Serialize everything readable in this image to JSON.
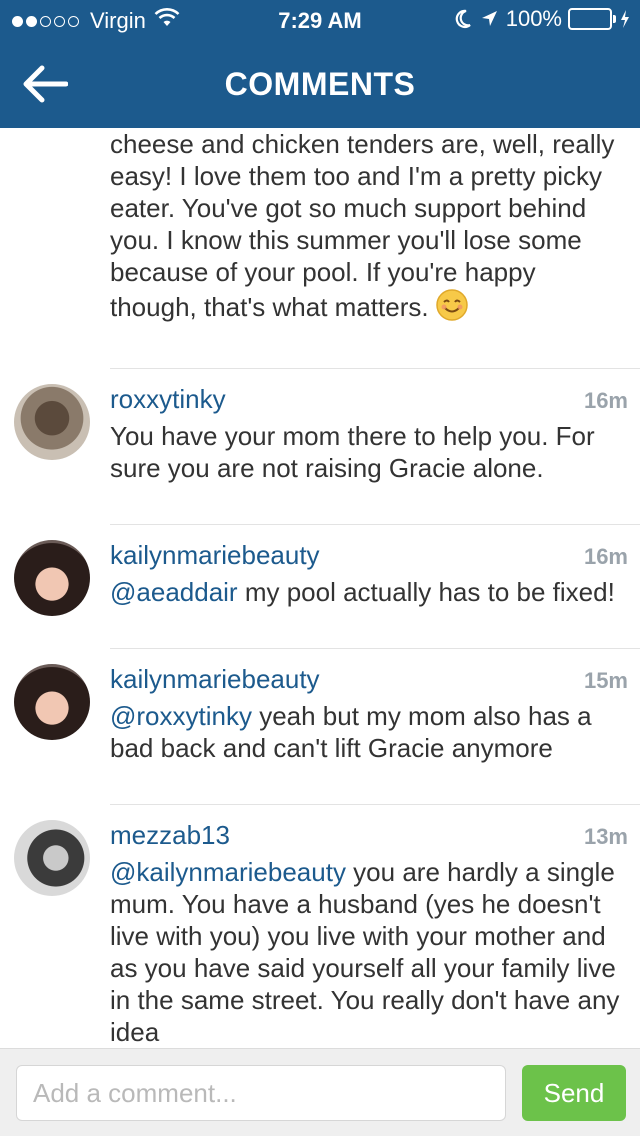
{
  "status_bar": {
    "carrier": "Virgin",
    "time": "7:29 AM",
    "battery": "100%",
    "battery_level": 1.0,
    "signal_bars_filled": 2,
    "signal_bars_total": 5
  },
  "nav": {
    "title": "COMMENTS",
    "back_icon": "arrow-left-icon"
  },
  "previous_comment": {
    "text": "cheese and chicken tenders are, well, really easy! I love them too and I'm a pretty picky eater. You've got so much support behind you. I know this summer you'll lose some because of your pool. If you're happy though, that's what matters.",
    "emoji": "smiling-face-icon"
  },
  "comments": [
    {
      "username": "roxxytinky",
      "time": "16m",
      "mention": "",
      "text": "You have your mom there to help you. For sure you are not raising Gracie alone."
    },
    {
      "username": "kailynmariebeauty",
      "time": "16m",
      "mention": "@aeaddair",
      "text": " my pool actually has to be fixed!"
    },
    {
      "username": "kailynmariebeauty",
      "time": "15m",
      "mention": "@roxxytinky",
      "text": " yeah but my mom also has a bad back and can't lift Gracie anymore"
    },
    {
      "username": "mezzab13",
      "time": "13m",
      "mention": "@kailynmariebeauty",
      "text": " you are hardly a single mum. You have a husband (yes he doesn't live with you) you live with your mother and as you have said yourself all your family live in the same street. You really don't have any idea"
    }
  ],
  "composer": {
    "placeholder": "Add a comment...",
    "value": "",
    "send_label": "Send"
  },
  "colors": {
    "header": "#1c5a8d",
    "link": "#1c5a8d",
    "send": "#6cc24a",
    "battery": "#4cd964"
  }
}
